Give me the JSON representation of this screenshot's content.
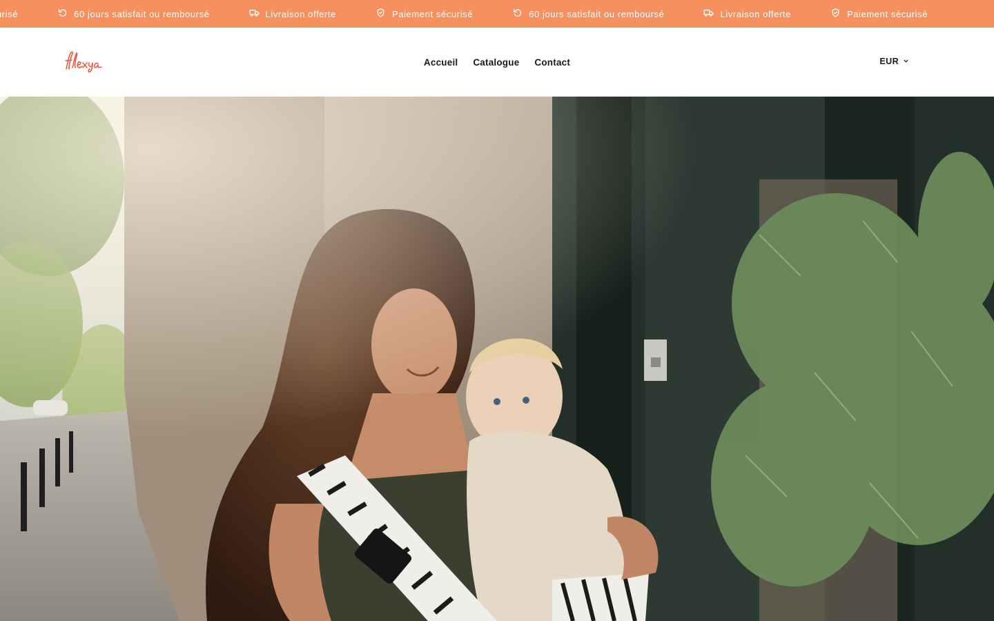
{
  "announcement": {
    "background": "#f7905f",
    "items": [
      {
        "icon": "shield-check-icon",
        "text": "Paiement sécurisé"
      },
      {
        "icon": "refresh-icon",
        "text": "60 jours satisfait ou remboursé"
      },
      {
        "icon": "truck-icon",
        "text": "Livraison offerte"
      },
      {
        "icon": "shield-check-icon",
        "text": "Paiement sécurisé"
      },
      {
        "icon": "refresh-icon",
        "text": "60 jours satisfait ou remboursé"
      },
      {
        "icon": "truck-icon",
        "text": "Livraison offerte"
      },
      {
        "icon": "shield-check-icon",
        "text": "Paiement sécurisé"
      }
    ]
  },
  "header": {
    "logo_text": "flexya",
    "logo_color": "#ef5a3f",
    "nav": [
      {
        "label": "Accueil"
      },
      {
        "label": "Catalogue"
      },
      {
        "label": "Contact"
      }
    ],
    "currency": "EUR"
  },
  "hero": {
    "image": "photo"
  }
}
